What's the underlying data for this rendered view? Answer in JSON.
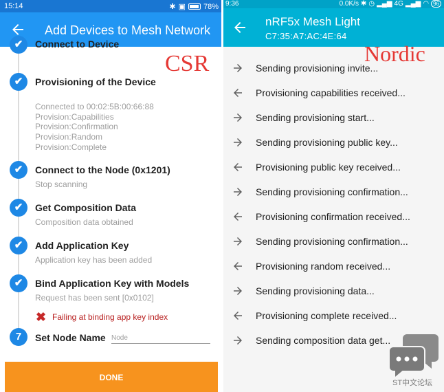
{
  "csr": {
    "status": {
      "time": "15:14",
      "battery": "78%"
    },
    "appbar": {
      "title": "Add Devices to Mesh Network"
    },
    "overlay_label": "CSR",
    "partial_step": "Connect to Device",
    "steps": [
      {
        "title": "Provisioning of the Device",
        "sub": [
          "Connected to 00:02:5B:00:66:88",
          "Provision:Capabilities",
          "Provision:Confirmation",
          "Provision:Random",
          "Provision:Complete"
        ]
      },
      {
        "title": "Connect to the Node (0x1201)",
        "sub": [
          "Stop scanning"
        ]
      },
      {
        "title": "Get Composition Data",
        "sub": [
          "Composition data obtained"
        ]
      },
      {
        "title": "Add Application Key",
        "sub": [
          "Application key has been added"
        ]
      },
      {
        "title": "Bind Application Key with Models",
        "sub": [
          "Request has been sent [0x0102]"
        ]
      }
    ],
    "error": {
      "icon": "cross-icon",
      "text": "Failing at binding app key index"
    },
    "step7": {
      "number": "7",
      "title": "Set Node Name",
      "placeholder": "Node"
    },
    "done_label": "DONE"
  },
  "nordic": {
    "status": {
      "time": "9:36",
      "speed": "0.0K/s",
      "network": "4G",
      "battery": "96"
    },
    "appbar": {
      "title": "nRF5x Mesh Light",
      "subtitle": "C7:35:A7:AC:4E:64"
    },
    "overlay_label": "Nordic",
    "messages": [
      {
        "dir": "out",
        "text": "Sending provisioning invite..."
      },
      {
        "dir": "in",
        "text": "Provisioning capabilities received..."
      },
      {
        "dir": "out",
        "text": "Sending provisioning start..."
      },
      {
        "dir": "out",
        "text": "Sending provisioning public key..."
      },
      {
        "dir": "in",
        "text": "Provisioning public key received..."
      },
      {
        "dir": "out",
        "text": "Sending provisioning confirmation..."
      },
      {
        "dir": "in",
        "text": "Provisioning confirmation received..."
      },
      {
        "dir": "out",
        "text": "Sending provisioning confirmation..."
      },
      {
        "dir": "in",
        "text": "Provisioning random received..."
      },
      {
        "dir": "out",
        "text": "Sending provisioning data..."
      },
      {
        "dir": "in",
        "text": "Provisioning complete received..."
      },
      {
        "dir": "out",
        "text": "Sending composition data get..."
      }
    ]
  },
  "watermark": {
    "text": "ST中文论坛"
  },
  "colors": {
    "csr_appbar": "#2196f3",
    "nordic_appbar": "#00b1d5",
    "done": "#f7931e",
    "check": "#1e88e5",
    "label_red": "#e53935"
  }
}
